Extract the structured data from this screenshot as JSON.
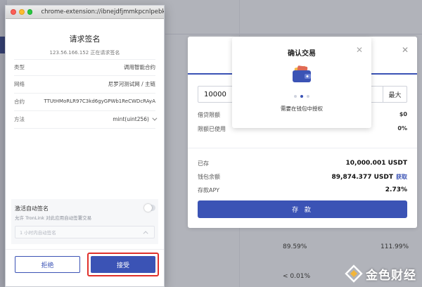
{
  "popup": {
    "url": "chrome-extension://ibnejdfjmmkpcnlpebklmn...",
    "title": "请求签名",
    "subtitle": "123.56.166.152 正在请求签名",
    "fields": [
      {
        "key": "类型",
        "value": "调用智能合约"
      },
      {
        "key": "网络",
        "value": "尼罗河测试网 / 主链"
      },
      {
        "key": "合约",
        "value": "TTUtHMoRLR97C3kd6gyGPWb1ReCWDcRAyA"
      },
      {
        "key": "方法",
        "value": "mint(uint256)"
      }
    ],
    "auto_sign": {
      "title": "激活自动签名",
      "description": "允许 TronLink 对此应用自动签署交易",
      "select_placeholder": "1 小时内自动签名",
      "enabled": false
    },
    "reject_label": "拒绝",
    "accept_label": "接受"
  },
  "confirm_modal": {
    "title": "确认交易",
    "hint": "需要在钱包中授权",
    "icon": "wallet-icon",
    "close_icon": "close-icon",
    "step_active": 1,
    "step_count": 3
  },
  "supply_modal": {
    "amount": "10000",
    "max_label": "最大",
    "rows": [
      {
        "label": "借贷限额",
        "value": "$0"
      },
      {
        "label": "限额已使用",
        "value": "0%"
      }
    ],
    "stats": [
      {
        "label": "已存",
        "value": "10,000.001 USDT"
      },
      {
        "label": "钱包余额",
        "value": "89,874.377 USDT",
        "link": "获取"
      },
      {
        "label": "存款APY",
        "value": "2.73%"
      }
    ],
    "button_label": "存 款"
  },
  "background": {
    "row1": [
      "89.59%",
      "111.99%"
    ],
    "row2": [
      "< 0.01%"
    ]
  },
  "watermark": {
    "text": "金色财经"
  },
  "colors": {
    "primary": "#3b53b5",
    "highlight": "#e0312c"
  }
}
